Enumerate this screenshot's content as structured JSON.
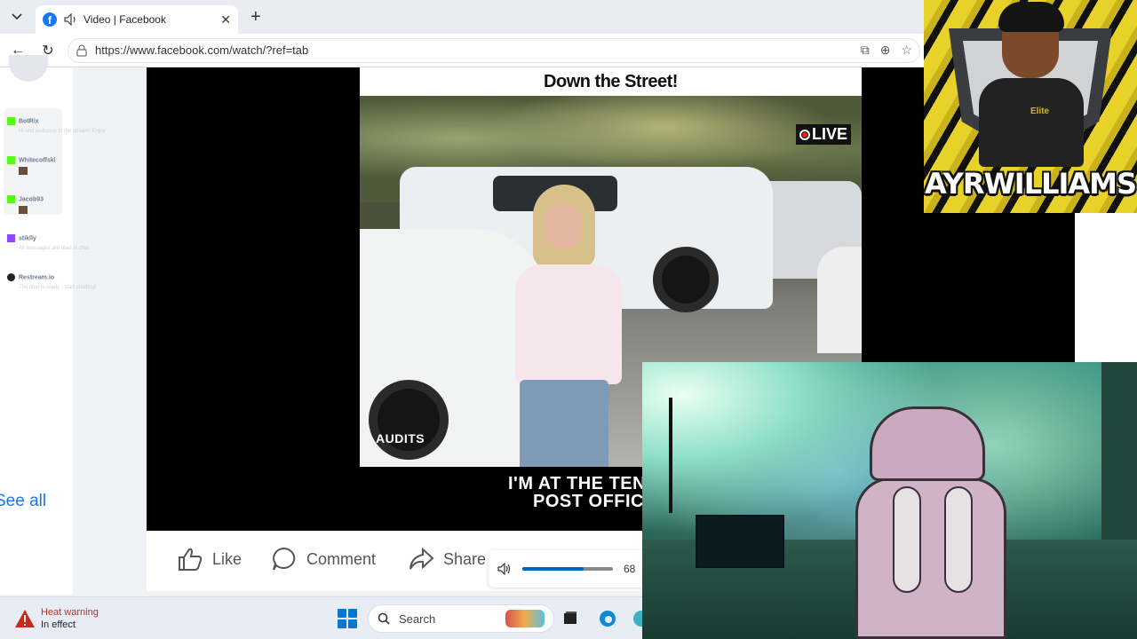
{
  "browser": {
    "tab_title": "Video | Facebook",
    "url": "https://www.facebook.com/watch/?ref=tab",
    "new_tab_label": "+"
  },
  "sidebar": {
    "chats": [
      {
        "name": "BotRix",
        "message": "Hi and welcome to the stream! Enjoy",
        "source": "kick"
      },
      {
        "name": "Whitecoffski",
        "message": "",
        "source": "kick"
      },
      {
        "name": "Jacob93",
        "message": "",
        "source": "kick"
      },
      {
        "name": "stiklly",
        "message": "All messages are read in chat",
        "source": "twitch"
      },
      {
        "name": "Restream.io",
        "message": "The chat is ready - start chatting!",
        "source": "restream"
      }
    ],
    "see_all_label": "See all"
  },
  "video": {
    "headline": "Down the Street!",
    "live_label": "LIVE",
    "watermark": "AUDITS",
    "caption_line1": "I'M AT THE TEN",
    "caption_line2": "POST OFFIC"
  },
  "actions": {
    "like_label": "Like",
    "comment_label": "Comment",
    "share_label": "Share"
  },
  "volume": {
    "level": 68,
    "level_label": "68"
  },
  "taskbar": {
    "weather_title": "Heat warning",
    "weather_sub": "In effect",
    "search_placeholder": "Search"
  },
  "overlay": {
    "logo_name": "AYRWILLIAMS",
    "badge_text": "Elite"
  },
  "colors": {
    "facebook_blue": "#1877f2",
    "kick_green": "#53fc18",
    "twitch_purple": "#9146ff",
    "windows_blue": "#0078d4"
  }
}
